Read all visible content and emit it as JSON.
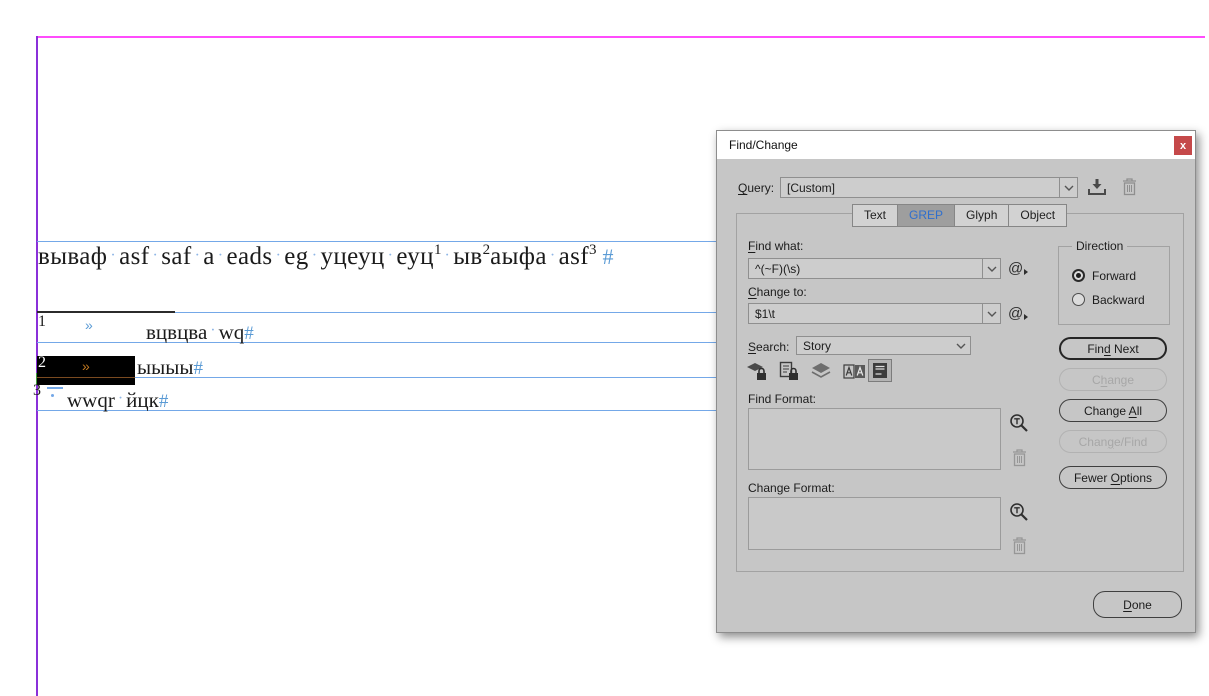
{
  "page": {
    "space_marker": "·",
    "end_of_story_marker": "#",
    "main_line": {
      "seg1": "вываф",
      "seg2": "asf",
      "seg3": "saf",
      "seg4": "a",
      "seg5": "eads",
      "seg6": "eg",
      "seg7": "уцеуц",
      "seg8": "еуц",
      "fnref1": "1",
      "seg9": "ыв",
      "fnref2": "2",
      "seg10": "аыфа",
      "seg11": "asf",
      "fnref3": "3"
    },
    "footnotes": {
      "fn1": {
        "num": "1",
        "tab_marker": "»",
        "word1": "вцвцва",
        "word2": "wq"
      },
      "fn2": {
        "num": "2",
        "tab_marker": "»",
        "word1": "ыыыы"
      },
      "fn3": {
        "num": "3",
        "word1": "wwqr",
        "word2": "йцк"
      }
    }
  },
  "dialog": {
    "title": "Find/Change",
    "close_label": "x",
    "query": {
      "label_key": "Q",
      "label_rest": "uery:",
      "value": "[Custom]"
    },
    "tabs": {
      "text": "Text",
      "grep": "GREP",
      "glyph": "Glyph",
      "object": "Object",
      "active": "GREP"
    },
    "find_what": {
      "label_key": "F",
      "label_rest": "ind what:",
      "value": "^(~F)(\\s)"
    },
    "change_to": {
      "label_key": "C",
      "label_rest": "hange to:",
      "value": "$1\\t"
    },
    "search": {
      "label_key": "S",
      "label_rest": "earch:",
      "value": "Story"
    },
    "at_menu": "@",
    "find_format_label": "Find Format:",
    "change_format_label": "Change Format:",
    "direction": {
      "legend": "Direction",
      "forward": "Forward",
      "backward": "Backward",
      "selected": "Forward"
    },
    "buttons": {
      "find_next": {
        "pre": "Fin",
        "key": "d",
        "post": " Next"
      },
      "change": {
        "pre": "C",
        "key": "h",
        "post": "ange"
      },
      "change_all": {
        "pre": "Change ",
        "key": "A",
        "post": "ll"
      },
      "change_find": {
        "pre": "Chan",
        "key": "g",
        "post": "e/Find"
      },
      "fewer_options": {
        "pre": "Fewer ",
        "key": "O",
        "post": "ptions"
      },
      "done": {
        "pre": "",
        "key": "D",
        "post": "one"
      }
    },
    "colors": {
      "close_button": "#c5494a",
      "active_tab_text": "#2f6fce",
      "guide_magenta": "#ff4cfc",
      "guide_violet": "#8a30d9",
      "frame_edge_blue": "#74a8e8",
      "marker_blue": "#5b9bd5",
      "selection_fill": "#000000",
      "selected_tab_marker_orange": "#c07820"
    }
  }
}
